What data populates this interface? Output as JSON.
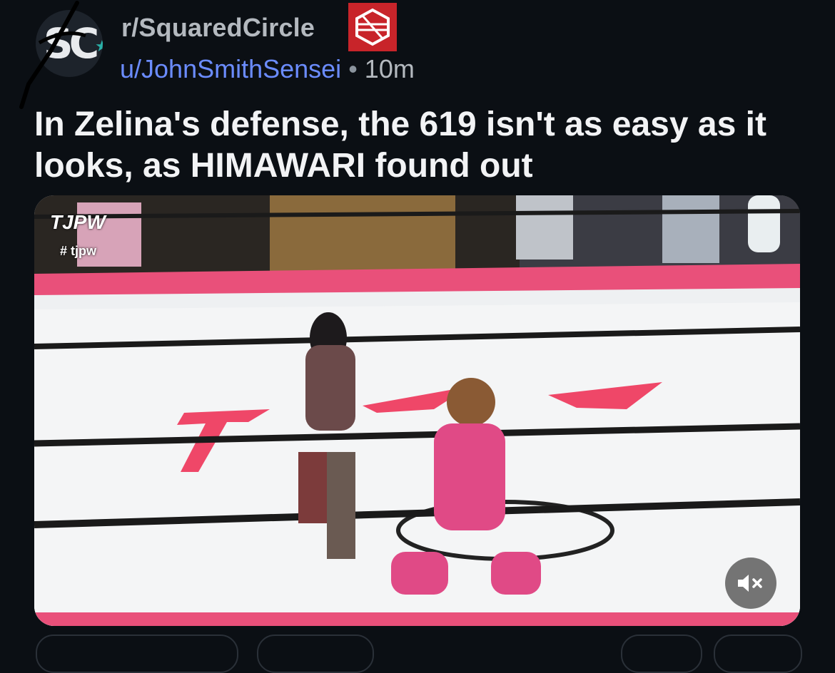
{
  "post": {
    "subreddit": "r/SquaredCircle",
    "username": "u/JohnSmithSensei",
    "separator": "•",
    "time_ago": "10m",
    "title": "In Zelina's defense, the 619 isn't as easy as it looks, as HIMAWARI found out",
    "avatar_text": "SC"
  },
  "video": {
    "watermark_logo": "TJPW",
    "watermark_tag": "# tjpw",
    "mute_icon": "speaker-muted-icon"
  },
  "colors": {
    "background": "#0b0f14",
    "username": "#6b8cff",
    "subreddit_badge": "#c8242a",
    "ring_apron": "#e94a72"
  }
}
